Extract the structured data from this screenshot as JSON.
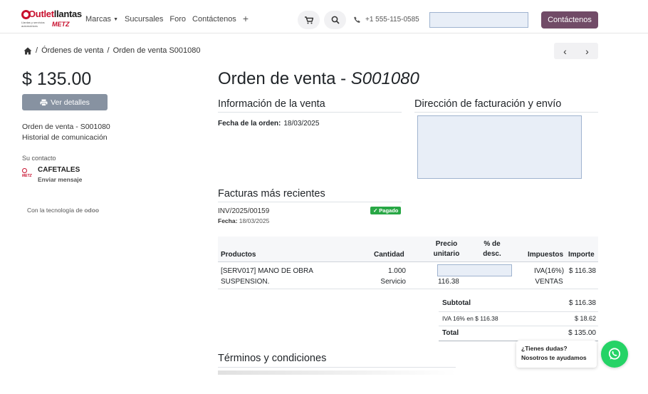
{
  "header": {
    "logo": {
      "word_outlet": "Outlet",
      "word_llantas": "llantas",
      "tagline": "Llantas y servicios automotrices",
      "brand": "METZ"
    },
    "nav": [
      {
        "label": "Marcas",
        "has_dropdown": true
      },
      {
        "label": "Sucursales",
        "has_dropdown": false
      },
      {
        "label": "Foro",
        "has_dropdown": false
      },
      {
        "label": "Contáctenos",
        "has_dropdown": false
      }
    ],
    "phone": "+1 555-115-0585",
    "contact_button": "Contáctenos"
  },
  "breadcrumb": {
    "items": [
      "Órdenes de venta",
      "Orden de venta S001080"
    ],
    "separator": "/"
  },
  "sidebar": {
    "amount": "$ 135.00",
    "details_button": "Ver detalles",
    "links": [
      "Orden de venta - S001080",
      "Historial de comunicación"
    ],
    "contact_heading": "Su contacto",
    "contact_name": "CAFETALES",
    "contact_action": "Enviar mensaje",
    "powered_by": "Con la tecnología de",
    "powered_brand": "odoo"
  },
  "main": {
    "title_prefix": "Orden de venta - ",
    "title_ref": "S001080",
    "sale_info": {
      "heading": "Información de la venta",
      "date_label": "Fecha de la orden:",
      "date_value": "18/03/2025"
    },
    "address": {
      "heading": "Dirección de facturación y envío"
    },
    "invoices": {
      "heading": "Facturas más recientes",
      "items": [
        {
          "number": "INV/2025/00159",
          "date_label": "Fecha:",
          "date": "18/03/2025",
          "status": "Pagado"
        }
      ]
    },
    "table": {
      "headers": [
        "Productos",
        "Cantidad",
        "Precio unitario",
        "% de desc.",
        "Impuestos",
        "Importe"
      ],
      "header_lines": {
        "unit_price": [
          "Precio",
          "unitario"
        ],
        "discount": [
          "% de",
          "desc."
        ]
      },
      "rows": [
        {
          "product_line1": "[SERV017] MANO DE OBRA",
          "product_line2": "SUSPENSION.",
          "qty": "1.000",
          "uom": "Servicio",
          "unit_price": "116.38",
          "tax_line1": "IVA(16%)",
          "tax_line2": "VENTAS",
          "amount": "$ 116.38"
        }
      ]
    },
    "totals": {
      "subtotal_label": "Subtotal",
      "subtotal_value": "$ 116.38",
      "tax_label": "IVA 16% en $ 116.38",
      "tax_value": "$ 18.62",
      "total_label": "Total",
      "total_value": "$ 135.00"
    },
    "terms_heading": "Términos y condiciones"
  },
  "chat": {
    "line1": "¿Tienes dudas?",
    "line2": "Nosotros te ayudamos"
  },
  "colors": {
    "primary": "#714b67",
    "secondary_button": "#8792a1",
    "paid_badge": "#28a745",
    "whatsapp": "#25d366",
    "logo_red": "#c8102e"
  }
}
